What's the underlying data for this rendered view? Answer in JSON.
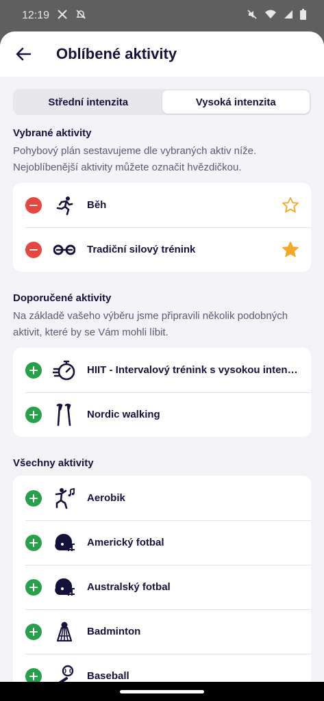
{
  "status": {
    "time": "12:19"
  },
  "header": {
    "title": "Oblíbené aktivity"
  },
  "tabs": [
    {
      "label": "Střední intenzita",
      "active": false
    },
    {
      "label": "Vysoká intenzita",
      "active": true
    }
  ],
  "selected": {
    "title": "Vybrané aktivity",
    "desc": "Pohybový plán sestavujeme dle vybraných aktiv níže. Nejoblíbenější aktivity můžete označit hvězdičkou.",
    "items": [
      {
        "name": "Běh",
        "icon": "running-icon",
        "starred": false
      },
      {
        "name": "Tradiční silový trénink",
        "icon": "dumbbell-icon",
        "starred": true
      }
    ]
  },
  "recommended": {
    "title": "Doporučené aktivity",
    "desc": "Na základě vašeho výběru jsme připravili několik podobných aktivit, které by se Vám mohli líbit.",
    "items": [
      {
        "name": "HIIT - Intervalový trénink s vysokou intenzitou",
        "icon": "stopwatch-icon"
      },
      {
        "name": "Nordic walking",
        "icon": "nordic-poles-icon"
      }
    ]
  },
  "all": {
    "title": "Všechny aktivity",
    "items": [
      {
        "name": "Aerobik",
        "icon": "aerobics-icon"
      },
      {
        "name": "Americký fotbal",
        "icon": "football-helmet-icon"
      },
      {
        "name": "Australský fotbal",
        "icon": "football-helmet-icon"
      },
      {
        "name": "Badminton",
        "icon": "shuttlecock-icon"
      },
      {
        "name": "Baseball",
        "icon": "baseball-icon"
      }
    ]
  },
  "colors": {
    "accent": "#14123a",
    "remove": "#e8453c",
    "add": "#27a04a",
    "star": "#f5a623"
  }
}
